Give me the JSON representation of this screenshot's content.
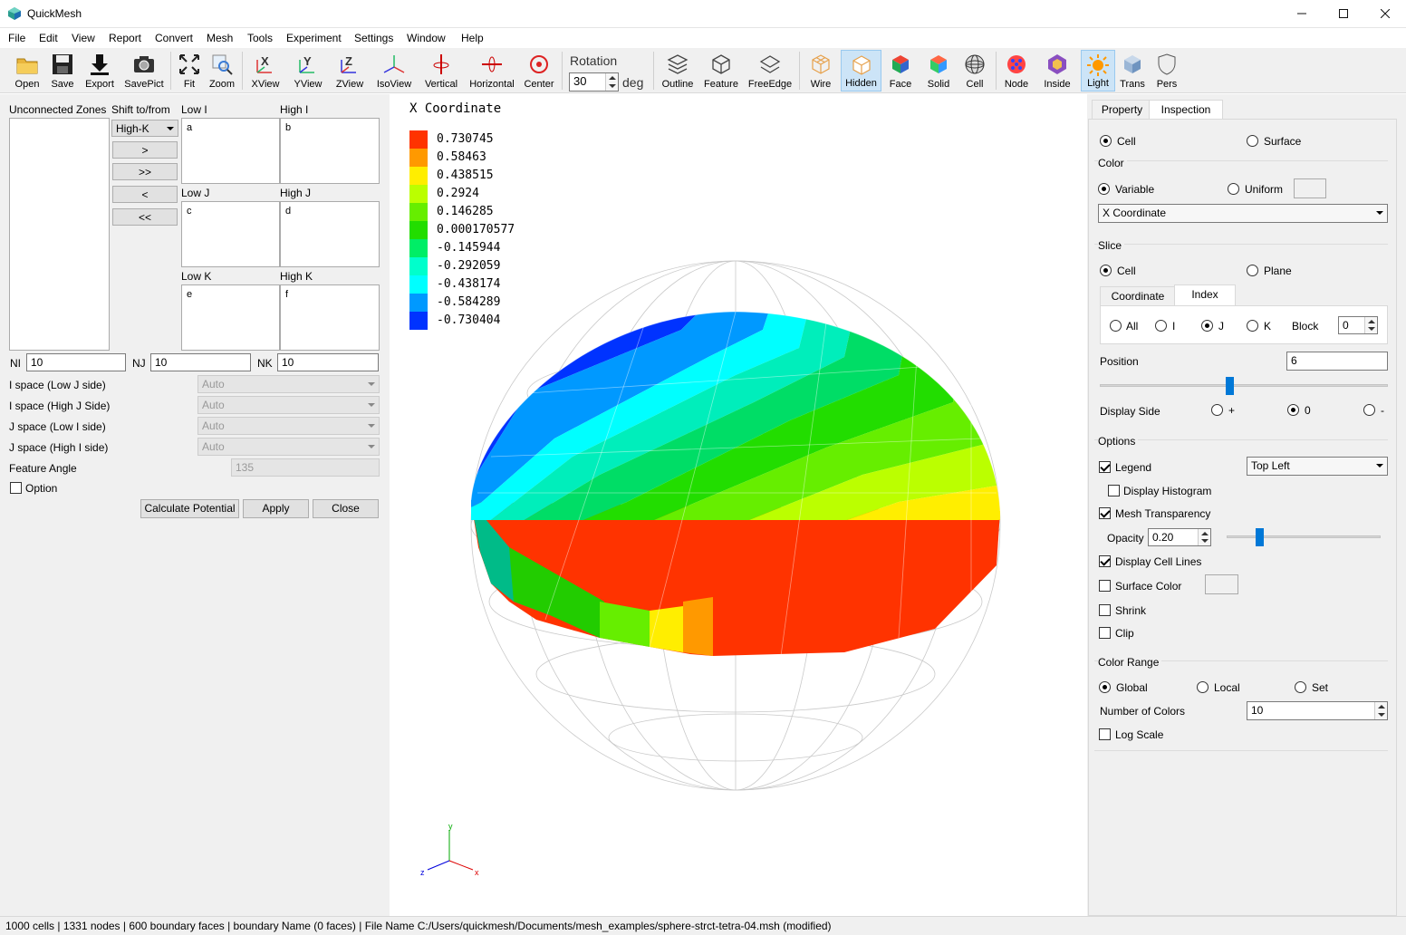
{
  "window": {
    "title": "QuickMesh",
    "min_icon": "minimize-icon",
    "max_icon": "maximize-icon",
    "close_icon": "close-icon"
  },
  "menu": [
    "File",
    "Edit",
    "View",
    "Report",
    "Convert",
    "Mesh",
    "Tools",
    "Experiment",
    "Settings",
    "Window",
    "Help"
  ],
  "toolbar": {
    "open": "Open",
    "save": "Save",
    "export": "Export",
    "savepict": "SavePict",
    "fit": "Fit",
    "zoom": "Zoom",
    "xview": "XView",
    "yview": "YView",
    "zview": "ZView",
    "isoview": "IsoView",
    "vertical": "Vertical",
    "horizontal": "Horizontal",
    "center": "Center",
    "rotation_label": "Rotation",
    "rotation_value": "30",
    "rotation_unit": "deg",
    "outline": "Outline",
    "feature": "Feature",
    "freeedge": "FreeEdge",
    "wire": "Wire",
    "hidden": "Hidden",
    "face": "Face",
    "solid": "Solid",
    "cell": "Cell",
    "node": "Node",
    "inside": "Inside",
    "light": "Light",
    "trans": "Trans",
    "pers": "Pers"
  },
  "left": {
    "unconnected_label": "Unconnected Zones",
    "shift_label": "Shift to/from",
    "shift_value": "High-K",
    "btn_right": ">",
    "btn_right_all": ">>",
    "btn_left": "<",
    "btn_left_all": "<<",
    "low_i": "Low I",
    "high_i": "High I",
    "low_j": "Low J",
    "high_j": "High J",
    "low_k": "Low K",
    "high_k": "High K",
    "box_a": "a",
    "box_b": "b",
    "box_c": "c",
    "box_d": "d",
    "box_e": "e",
    "box_f": "f",
    "ni_label": "NI",
    "ni_value": "10",
    "nj_label": "NJ",
    "nj_value": "10",
    "nk_label": "NK",
    "nk_value": "10",
    "ispace_low_j": "I space (Low J side)",
    "ispace_high_j": "I space (High J Side)",
    "jspace_low_i": "J space (Low I side)",
    "jspace_high_i": "J space (High I side)",
    "auto": "Auto",
    "feature_angle_label": "Feature Angle",
    "feature_angle_value": "135",
    "option_label": "Option",
    "calc_btn": "Calculate Potential",
    "apply_btn": "Apply",
    "close_btn": "Close"
  },
  "legend": {
    "title": "X Coordinate",
    "entries": [
      {
        "value": "0.730745",
        "color": "#ff3300"
      },
      {
        "value": "0.58463",
        "color": "#ff9900"
      },
      {
        "value": "0.438515",
        "color": "#ffee00"
      },
      {
        "value": "0.2924",
        "color": "#bbff00"
      },
      {
        "value": "0.146285",
        "color": "#66ee00"
      },
      {
        "value": "0.000170577",
        "color": "#22dd00"
      },
      {
        "value": "-0.145944",
        "color": "#00ee66"
      },
      {
        "value": "-0.292059",
        "color": "#00ffcc"
      },
      {
        "value": "-0.438174",
        "color": "#00ffff"
      },
      {
        "value": "-0.584289",
        "color": "#0099ff"
      },
      {
        "value": "-0.730404",
        "color": "#0033ff"
      }
    ]
  },
  "axes": {
    "x": "x",
    "y": "y",
    "z": "z"
  },
  "right": {
    "tab_property": "Property",
    "tab_inspection": "Inspection",
    "cell": "Cell",
    "surface": "Surface",
    "color_group": "Color",
    "variable": "Variable",
    "uniform": "Uniform",
    "variable_select": "X Coordinate",
    "slice_group": "Slice",
    "slice_cell": "Cell",
    "slice_plane": "Plane",
    "tab_coordinate": "Coordinate",
    "tab_index": "Index",
    "idx_all": "All",
    "idx_i": "I",
    "idx_j": "J",
    "idx_k": "K",
    "block_label": "Block",
    "block_value": "0",
    "position_label": "Position",
    "position_value": "6",
    "position_fraction": 0.45,
    "display_side_label": "Display Side",
    "side_plus": "+",
    "side_zero": "0",
    "side_minus": "-",
    "options_group": "Options",
    "legend_label": "Legend",
    "legend_pos": "Top Left",
    "display_histogram": "Display Histogram",
    "mesh_transparency": "Mesh Transparency",
    "opacity_label": "Opacity",
    "opacity_value": "0.20",
    "display_cell_lines": "Display Cell Lines",
    "surface_color": "Surface Color",
    "shrink": "Shrink",
    "clip": "Clip",
    "color_range_group": "Color Range",
    "global": "Global",
    "local": "Local",
    "set": "Set",
    "num_colors_label": "Number of Colors",
    "num_colors_value": "10",
    "log_scale": "Log Scale"
  },
  "status": "1000 cells | 1331 nodes | 600 boundary faces |  boundary Name  (0 faces) | File Name C:/Users/quickmesh/Documents/mesh_examples/sphere-strct-tetra-04.msh (modified)"
}
